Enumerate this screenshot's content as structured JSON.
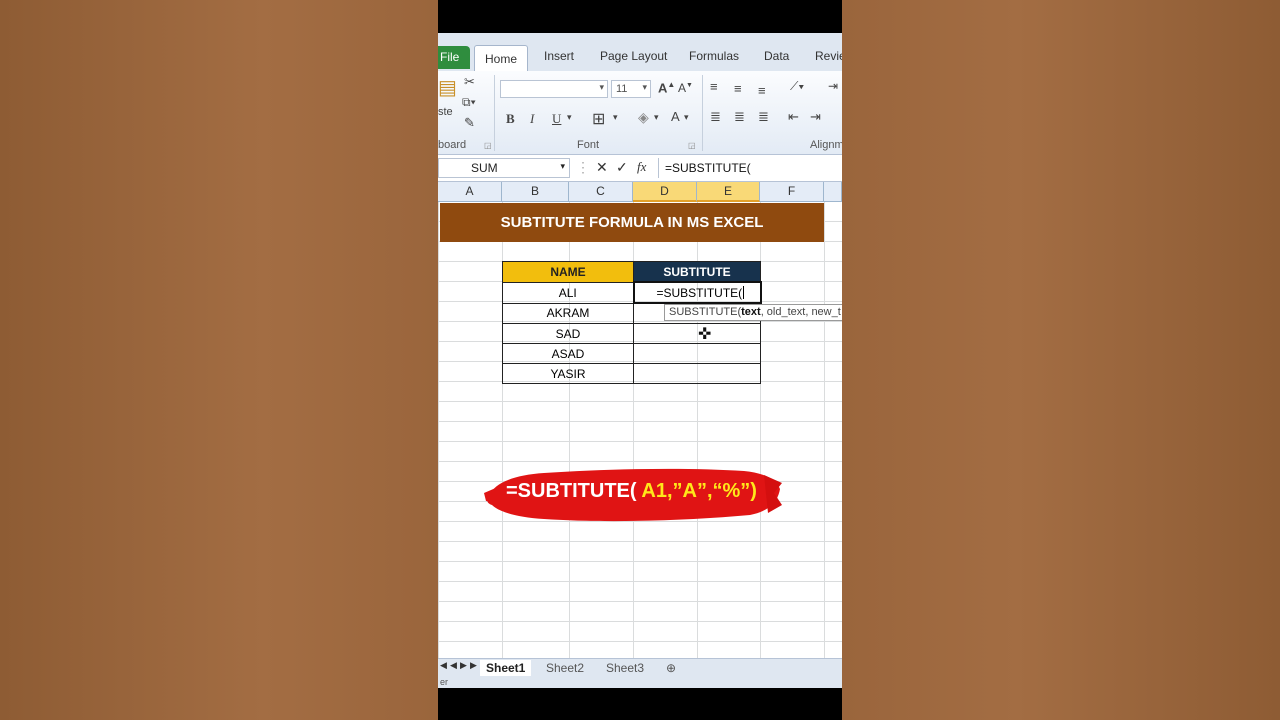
{
  "ribbon": {
    "tabs": {
      "file": "File",
      "home": "Home",
      "insert": "Insert",
      "page_layout": "Page Layout",
      "formulas": "Formulas",
      "data": "Data",
      "review": "Revie"
    },
    "clipboard_label": "board",
    "paste_label": "ste",
    "font_label": "Font",
    "alignment_label": "Alignm",
    "font_name": "",
    "font_size": "11"
  },
  "formula_bar": {
    "name_box": "SUM",
    "formula": "=SUBSTITUTE("
  },
  "columns": [
    "A",
    "B",
    "C",
    "D",
    "E",
    "F"
  ],
  "banner": "SUBTITUTE FORMULA IN MS EXCEL",
  "table": {
    "headers": [
      "NAME",
      "SUBTITUTE"
    ],
    "rows": [
      "ALI",
      "AKRAM",
      "SAD",
      "ASAD",
      "YASIR"
    ],
    "edit_value": "=SUBSTITUTE("
  },
  "tooltip": {
    "fn": "SUBSTITUTE(",
    "arg1": "text",
    "rest": ", old_text, new_t"
  },
  "callout": {
    "prefix": "=SUBTITUTE( ",
    "args": "A1,”A”,“%”)"
  },
  "sheets": [
    "Sheet1",
    "Sheet2",
    "Sheet3"
  ],
  "status": "er"
}
